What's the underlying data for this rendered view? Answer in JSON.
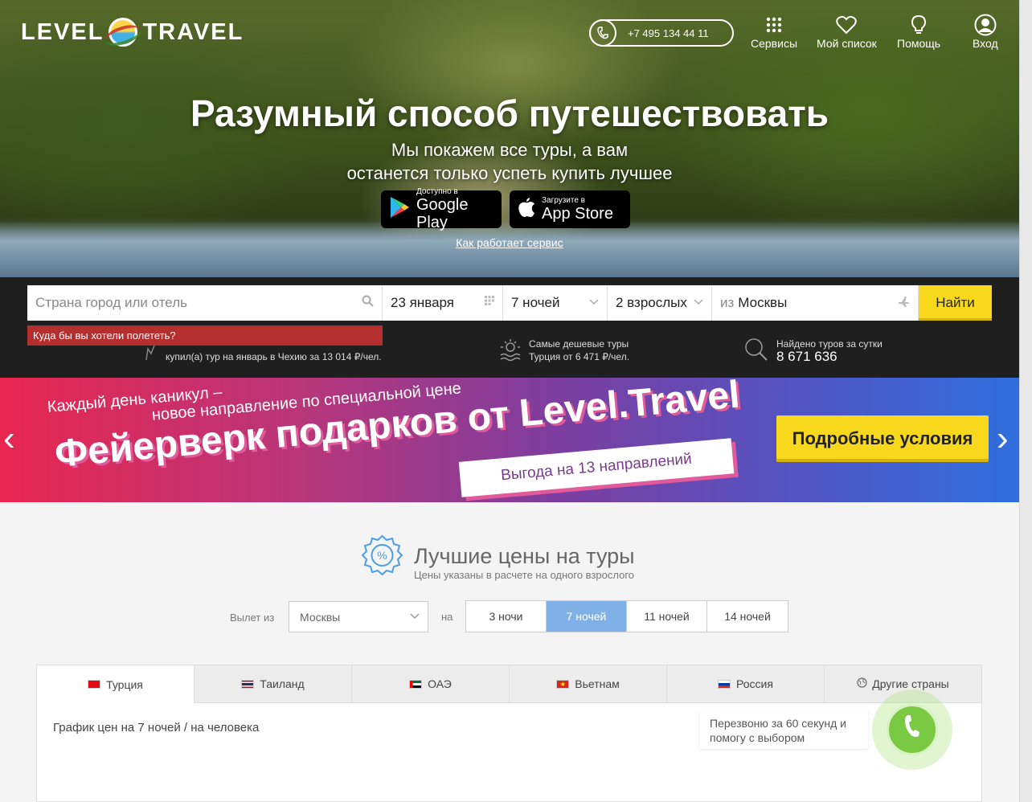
{
  "header": {
    "logo_left": "LEVEL",
    "logo_right": "TRAVEL",
    "phone": "+7 495 134 44 11",
    "nav": [
      {
        "label": "Сервисы",
        "icon": "grid-icon"
      },
      {
        "label": "Мой список",
        "icon": "heart-icon"
      },
      {
        "label": "Помощь",
        "icon": "lightbulb-icon"
      },
      {
        "label": "Вход",
        "icon": "user-icon"
      }
    ]
  },
  "hero": {
    "title": "Разумный способ путешествовать",
    "subtitle_line1": "Мы покажем все туры, а вам",
    "subtitle_line2": "останется только успеть купить лучшее",
    "google_small": "Доступно в",
    "google_big": "Google Play",
    "apple_small": "Загрузите в",
    "apple_big": "App Store",
    "how_link": "Как работает сервис"
  },
  "search": {
    "destination_placeholder": "Страна город или отель",
    "date": "23 января",
    "nights": "7 ночей",
    "guests": "2 взрослых",
    "from_prefix": "из",
    "from_city": "Москвы",
    "find_button": "Найти",
    "tooltip": "Куда бы вы хотели полететь?"
  },
  "stats": {
    "recent_line2": "купил(а) тур на январь в Чехию за 13 014 ₽/чел.",
    "cheap_title": "Самые дешевые туры",
    "cheap_value": "Турция от 6 471 ₽/чел.",
    "found_title": "Найдено туров за сутки",
    "found_value": "8 671 636"
  },
  "banner": {
    "line1": "Каждый день каникул –",
    "line2": "новое направление по специальной цене",
    "title": "Фейерверк подарков от Level.Travel",
    "ribbon": "Выгода на 13 направлений",
    "button": "Подробные условия",
    "arrow_left": "‹",
    "arrow_right": "›"
  },
  "best_prices": {
    "title": "Лучшие цены на туры",
    "subtitle": "Цены указаны в расчете на одного взрослого",
    "departure_label": "Вылет из",
    "departure_value": "Москвы",
    "na_label": "на",
    "nights": [
      "3 ночи",
      "7 ночей",
      "11 ночей",
      "14 ночей"
    ],
    "active_night_index": 1,
    "tabs": [
      {
        "label": "Турция",
        "flag_colors": [
          "#e30a17",
          "#e30a17"
        ]
      },
      {
        "label": "Таиланд",
        "flag_colors": [
          "#a51931",
          "#2d2a4a"
        ]
      },
      {
        "label": "ОАЭ",
        "flag_colors": [
          "#00732f",
          "#000000"
        ]
      },
      {
        "label": "Вьетнам",
        "flag_colors": [
          "#da251d",
          "#da251d"
        ]
      },
      {
        "label": "Россия",
        "flag_colors": [
          "#ffffff",
          "#0039a6"
        ]
      },
      {
        "label": "Другие страны",
        "flag_colors": [
          "#ffffff",
          "#ffffff"
        ]
      }
    ],
    "active_tab_index": 0,
    "graph_label": "График цен на 7 ночей / на человека"
  },
  "callback": {
    "text": "Перезвоню за 60 секунд и помогу с выбором"
  },
  "colors": {
    "accent_yellow": "#f8d81c",
    "tooltip_red": "#b62f2f",
    "active_night": "#7fb0e6",
    "callback_green": "#7ac943"
  }
}
